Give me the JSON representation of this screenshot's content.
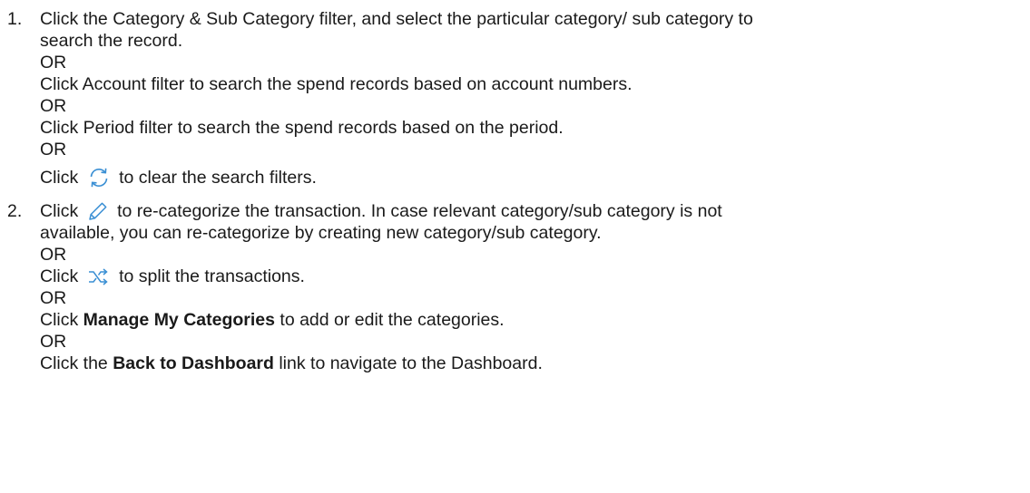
{
  "steps": [
    {
      "number": "1.",
      "lines": {
        "l1": "Click the Category & Sub Category filter, and select the particular category/ sub category to",
        "l2": "search the record.",
        "or1": "OR",
        "l3": "Click Account filter to search the spend records based on account numbers.",
        "or2": "OR",
        "l4": "Click Period filter to search the spend records based on the period.",
        "or3": "OR",
        "l5_pre": "Click",
        "l5_post": "to clear the search filters."
      },
      "icons": {
        "refresh": "refresh-icon"
      }
    },
    {
      "number": "2.",
      "lines": {
        "l1_pre": "Click",
        "l1_post": "to re-categorize the transaction. In case relevant category/sub category is not",
        "l2": "available, you can re-categorize by creating new category/sub category.",
        "or1": "OR",
        "l3_pre": "Click",
        "l3_post": "to split the transactions.",
        "or2": "OR",
        "l4_pre": "Click",
        "l4_bold": "Manage My Categories",
        "l4_post": "to add or edit the categories.",
        "or3": "OR",
        "l5_pre": "Click the",
        "l5_bold": "Back to Dashboard",
        "l5_post": "link to navigate to the Dashboard."
      },
      "icons": {
        "edit": "pencil-icon",
        "split": "shuffle-icon"
      }
    }
  ],
  "colors": {
    "text": "#1a1a1a",
    "icon_blue": "#3a8fd4"
  }
}
